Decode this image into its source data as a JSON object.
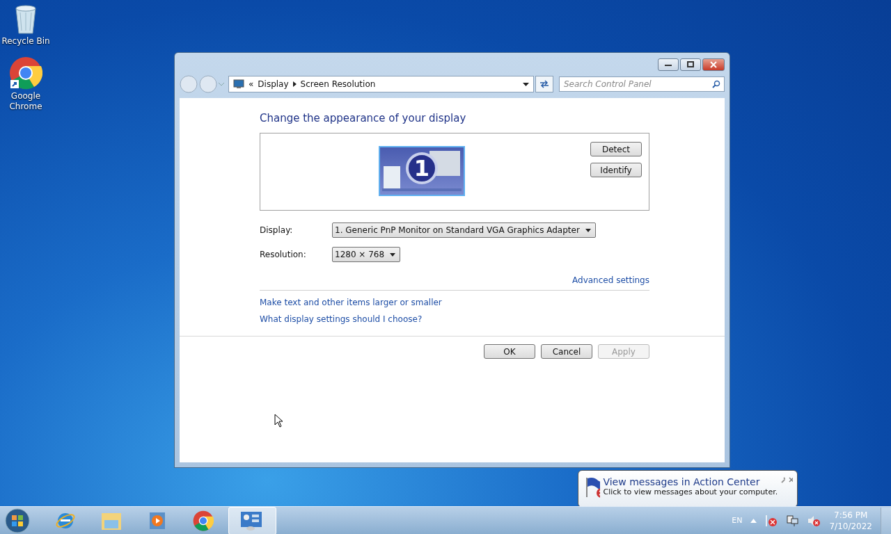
{
  "desktop_icons": [
    {
      "kind": "recycle-bin",
      "label": "Recycle Bin"
    },
    {
      "kind": "chrome",
      "label": "Google Chrome"
    }
  ],
  "window": {
    "address": {
      "prefix": "«",
      "crumbs": [
        "Display",
        "Screen Resolution"
      ]
    },
    "search": {
      "placeholder": "Search Control Panel"
    },
    "heading": "Change the appearance of your display",
    "monitor_number": "1",
    "side_buttons": [
      "Detect",
      "Identify"
    ],
    "fields": [
      {
        "label": "Display:",
        "value": "1. Generic PnP Monitor on Standard VGA Graphics Adapter"
      },
      {
        "label": "Resolution:",
        "value": "1280 × 768"
      }
    ],
    "advanced_link": "Advanced settings",
    "links": [
      "Make text and other items larger or smaller",
      "What display settings should I choose?"
    ],
    "buttons": [
      {
        "label": "OK",
        "disabled": false
      },
      {
        "label": "Cancel",
        "disabled": false
      },
      {
        "label": "Apply",
        "disabled": true
      }
    ]
  },
  "notification": {
    "title": "View messages in Action Center",
    "message": "Click to view messages about your computer."
  },
  "taskbar": {
    "apps": [
      {
        "kind": "ie",
        "selected": false
      },
      {
        "kind": "explorer",
        "selected": false
      },
      {
        "kind": "media",
        "selected": false
      },
      {
        "kind": "chrome",
        "selected": false
      },
      {
        "kind": "control-panel",
        "selected": true
      }
    ],
    "language": "EN",
    "time": "7:56 PM",
    "date": "7/10/2022"
  }
}
